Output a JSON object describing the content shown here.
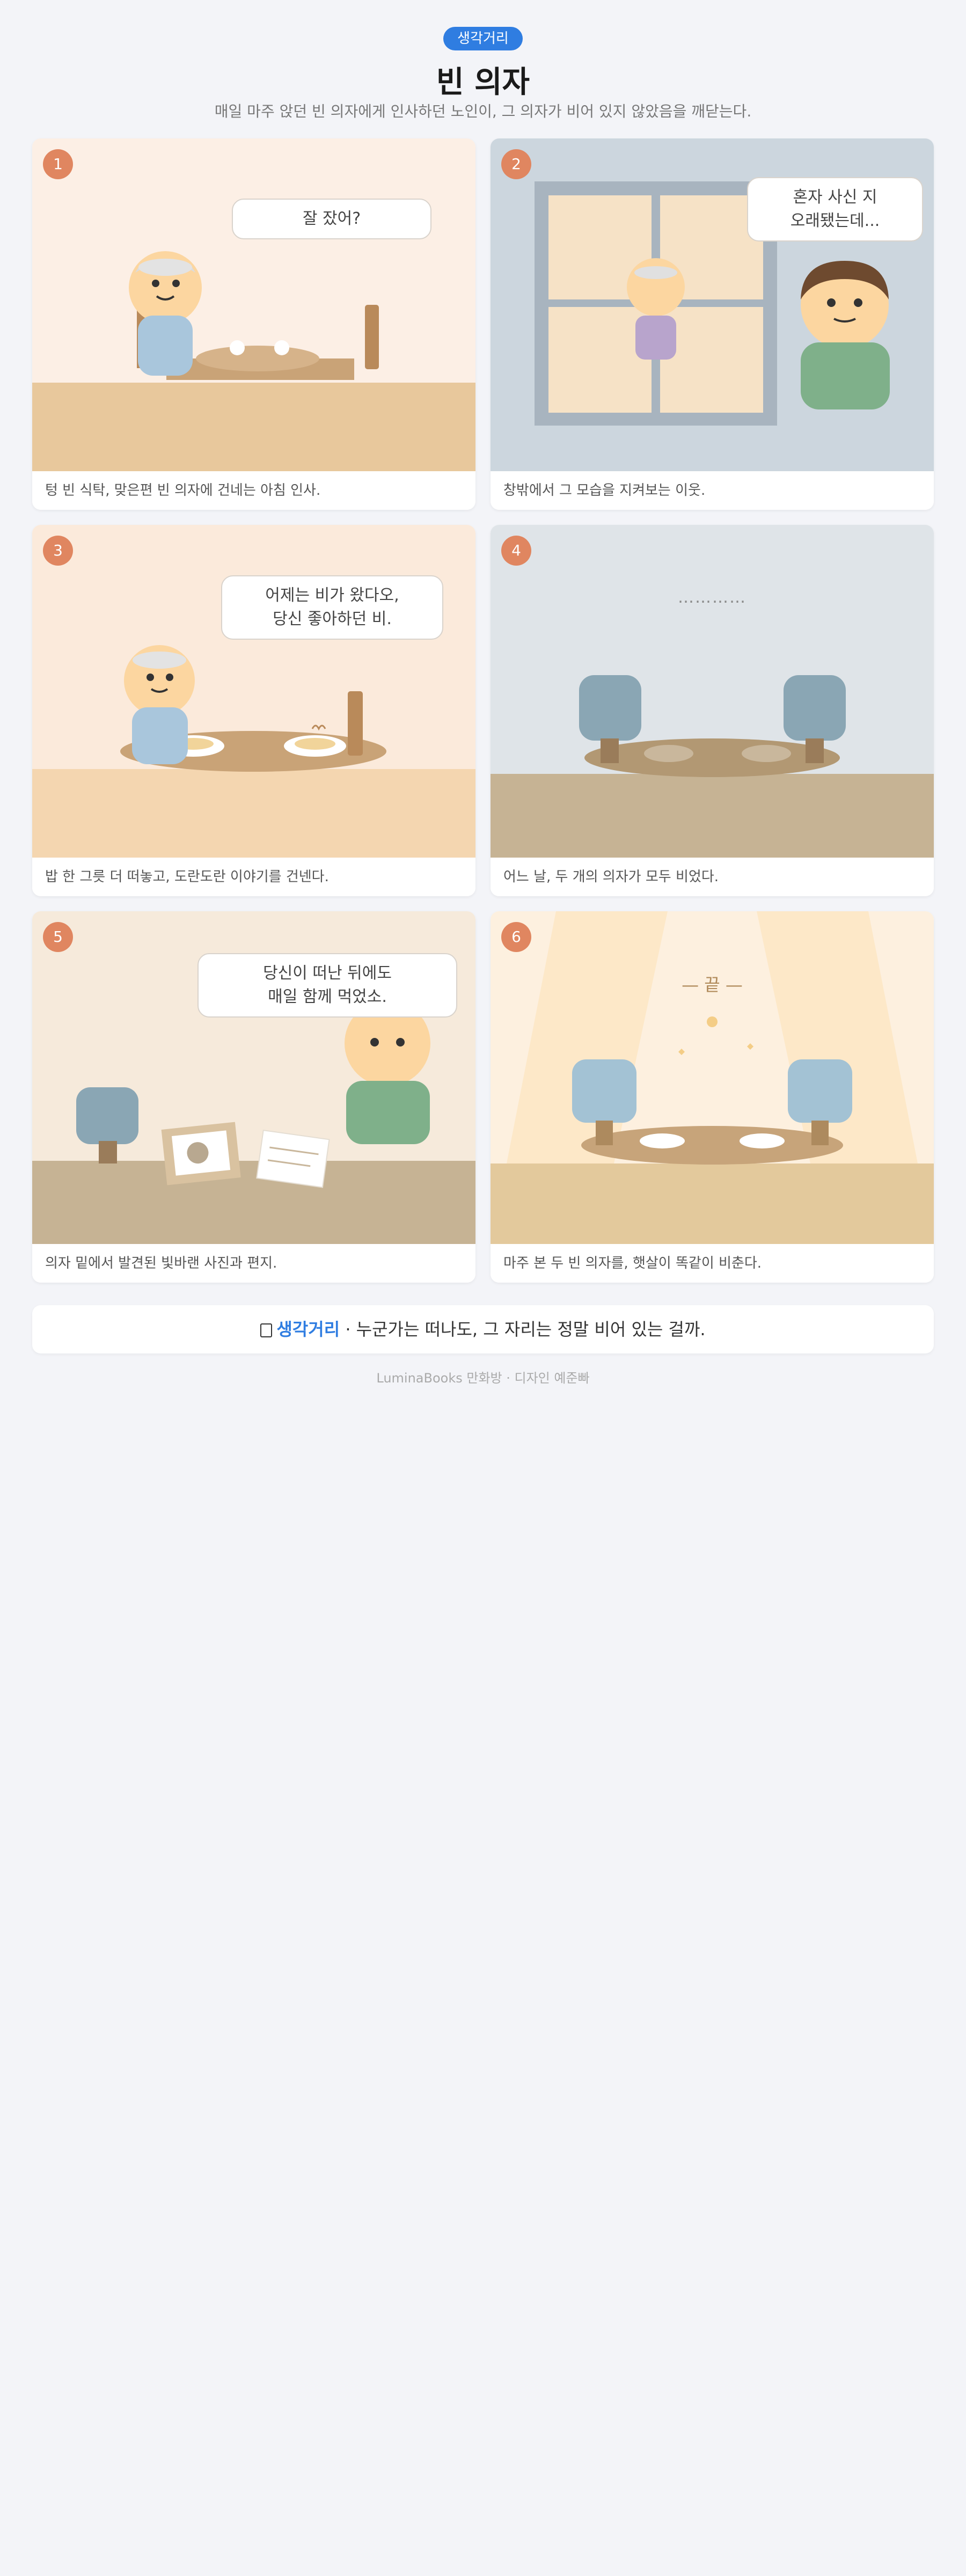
{
  "header": {
    "badge": "생각거리",
    "title": "빈 의자",
    "subtitle": "매일 마주 앉던 빈 의자에게 인사하던 노인이, 그 의자가 비어 있지 않았음을 깨닫는다."
  },
  "panels": [
    {
      "number": "1",
      "bubble": [
        "잘 잤어?"
      ],
      "caption": "텅 빈 식탁, 맞은편 빈 의자에 건네는 아침 인사."
    },
    {
      "number": "2",
      "bubble": [
        "혼자 사신 지",
        "오래됐는데..."
      ],
      "caption": "창밖에서 그 모습을 지켜보는 이웃."
    },
    {
      "number": "3",
      "bubble": [
        "어제는 비가 왔다오,",
        "당신 좋아하던 비."
      ],
      "caption": "밥 한 그릇 더 떠놓고, 도란도란 이야기를 건넨다."
    },
    {
      "number": "4",
      "dots": "…………",
      "caption": "어느 날, 두 개의 의자가 모두 비었다."
    },
    {
      "number": "5",
      "bubble": [
        "당신이 떠난 뒤에도",
        "매일 함께 먹었소."
      ],
      "caption": "의자 밑에서 발견된 빛바랜 사진과 편지."
    },
    {
      "number": "6",
      "end_mark": "— 끝 —",
      "caption": "마주 본 두 빈 의자를, 햇살이 똑같이 비춘다."
    }
  ],
  "footer": {
    "icon": "thought-icon",
    "brand": "생각거리",
    "text": " · 누군가는 떠나도, 그 자리는 정말 비어 있는 걸까."
  },
  "credit": "LuminaBooks 만화방 · 디자인 예준빠",
  "colors": {
    "accent": "#2f7de1",
    "number_badge": "#e08660",
    "page_bg": "#f3f4f8"
  }
}
